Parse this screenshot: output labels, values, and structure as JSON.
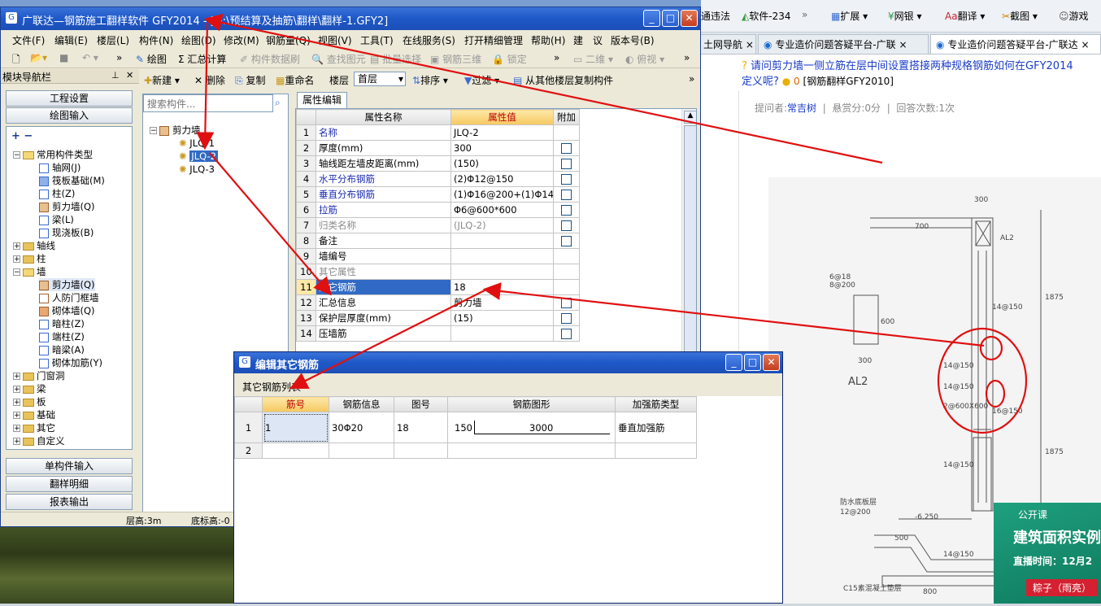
{
  "browser": {
    "toolbar": {
      "item1": "通违法",
      "item2": "软件-234",
      "more": "»",
      "item3": "扩展",
      "item4": "网银",
      "item5": "翻译",
      "item6": "截图",
      "item7": "游戏"
    },
    "tabs": [
      {
        "label": "土网导航"
      },
      {
        "label": "专业造价问题答疑平台-广联"
      },
      {
        "label": "专业造价问题答疑平台-广联达"
      }
    ],
    "question": {
      "title_line1": "请问剪力墙一侧立筋在层中间设置搭接两种规格钢筋如何在GFY2014",
      "title_line2": "定义呢?",
      "score": "0",
      "tag": "[钢筋翻样GFY2010]",
      "asker_label": "提问者:",
      "asker": "常吉树",
      "reward": "悬赏分:0分",
      "answers": "回答次数:1次"
    },
    "drawing": {
      "labels": [
        "300",
        "700",
        "AL2",
        "1875",
        "1875",
        "6@18",
        "8@200",
        "600",
        "300",
        "AL2",
        "14@150",
        "14@150",
        "14@150",
        "14@150",
        "14@150",
        "16@150",
        "2@600X600",
        "12@200",
        "-6.250",
        "500",
        "800",
        "C15素混凝土垫层",
        "防水底板层"
      ]
    },
    "ad": {
      "tag": "公开课",
      "title": "建筑面积实例",
      "time": "直播时间：12月2",
      "host": "粽子（雨亮）"
    }
  },
  "app": {
    "title": "广联达—钢筋施工翻样软件 GFY2014 - [D:\\预结算及抽筋\\翻样\\翻样-1.GFY2]",
    "menu": [
      "文件(F)",
      "编辑(E)",
      "楼层(L)",
      "构件(N)",
      "绘图(D)",
      "修改(M)",
      "钢筋量(Q)",
      "视图(V)",
      "工具(T)",
      "在线服务(S)",
      "打开精细管理",
      "帮助(H)",
      "建",
      "议",
      "版本号(B)"
    ],
    "toolbar1": {
      "draw": "绘图",
      "sum": "Σ 汇总计算",
      "comp_data": "构件数据刷",
      "find": "查找图元",
      "batch": "批量选择",
      "rebar3d": "钢筋三维",
      "lock": "锁定",
      "view2d": "二维",
      "view_angle": "俯视"
    },
    "nav": {
      "title": "模块导航栏",
      "buttons": [
        "工程设置",
        "绘图输入",
        "单构件输入",
        "翻样明细",
        "报表输出"
      ],
      "tree": {
        "common_types": "常用构件类型",
        "common_children": [
          "轴网(J)",
          "筏板基础(M)",
          "柱(Z)",
          "剪力墙(Q)",
          "梁(L)",
          "现浇板(B)"
        ],
        "axis": "轴线",
        "column": "柱",
        "wall": "墙",
        "wall_children": [
          "剪力墙(Q)",
          "人防门框墙",
          "砌体墙(Q)",
          "暗柱(Z)",
          "端柱(Z)",
          "暗梁(A)",
          "砌体加筋(Y)"
        ],
        "others": [
          "门窗洞",
          "梁",
          "板",
          "基础",
          "其它",
          "自定义"
        ]
      }
    },
    "toolbar2": {
      "new": "新建",
      "delete": "删除",
      "copy": "复制",
      "rename": "重命名",
      "floor_label": "楼层",
      "floor_value": "首层",
      "sort": "排序",
      "filter": "过滤",
      "copy_from": "从其他楼层复制构件"
    },
    "search_placeholder": "搜索构件...",
    "comp_tree": {
      "root": "剪力墙",
      "items": [
        "JLQ-1",
        "JLQ-2",
        "JLQ-3"
      ]
    },
    "prop": {
      "tab": "属性编辑",
      "headers": {
        "name": "属性名称",
        "value": "属性值",
        "extra": "附加"
      },
      "rows": [
        {
          "n": "1",
          "name": "名称",
          "value": "JLQ-2",
          "cls": "blue",
          "chk": false
        },
        {
          "n": "2",
          "name": "厚度(mm)",
          "value": "300",
          "cls": "",
          "chk": true
        },
        {
          "n": "3",
          "name": "轴线距左墙皮距离(mm)",
          "value": "(150)",
          "cls": "",
          "chk": true
        },
        {
          "n": "4",
          "name": "水平分布钢筋",
          "value": "(2)Φ12@150",
          "cls": "blue",
          "chk": true
        },
        {
          "n": "5",
          "name": "垂直分布钢筋",
          "value": "(1)Φ16@200+(1)Φ14",
          "cls": "blue",
          "chk": true
        },
        {
          "n": "6",
          "name": "拉筋",
          "value": "Φ6@600*600",
          "cls": "blue",
          "chk": true
        },
        {
          "n": "7",
          "name": "归类名称",
          "value": "(JLQ-2)",
          "cls": "gray",
          "chk": true
        },
        {
          "n": "8",
          "name": "备注",
          "value": "",
          "cls": "",
          "chk": true
        },
        {
          "n": "9",
          "name": "墙编号",
          "value": "",
          "cls": "",
          "chk": false
        },
        {
          "n": "10",
          "name": "其它属性",
          "value": "",
          "cls": "gray",
          "chk": false
        },
        {
          "n": "11",
          "name": "其它钢筋",
          "value": "18",
          "cls": "",
          "chk": false
        },
        {
          "n": "12",
          "name": "汇总信息",
          "value": "剪力墙",
          "cls": "",
          "chk": true
        },
        {
          "n": "13",
          "name": "保护层厚度(mm)",
          "value": "(15)",
          "cls": "",
          "chk": true
        },
        {
          "n": "14",
          "name": "压墙筋",
          "value": "",
          "cls": "",
          "chk": true
        }
      ]
    },
    "status": {
      "floor_height": "层高:3m",
      "base_elev": "底标高:-0"
    }
  },
  "dialog": {
    "title": "编辑其它钢筋",
    "list_label": "其它钢筋列表",
    "headers": [
      "筋号",
      "钢筋信息",
      "图号",
      "钢筋图形",
      "加强筋类型"
    ],
    "rows": [
      {
        "n": "1",
        "id": "1",
        "info": "30Φ20",
        "fig": "18",
        "shape_left": "150",
        "shape_len": "3000",
        "type": "垂直加强筋"
      },
      {
        "n": "2",
        "id": "",
        "info": "",
        "fig": "",
        "shape_left": "",
        "shape_len": "",
        "type": ""
      }
    ]
  }
}
